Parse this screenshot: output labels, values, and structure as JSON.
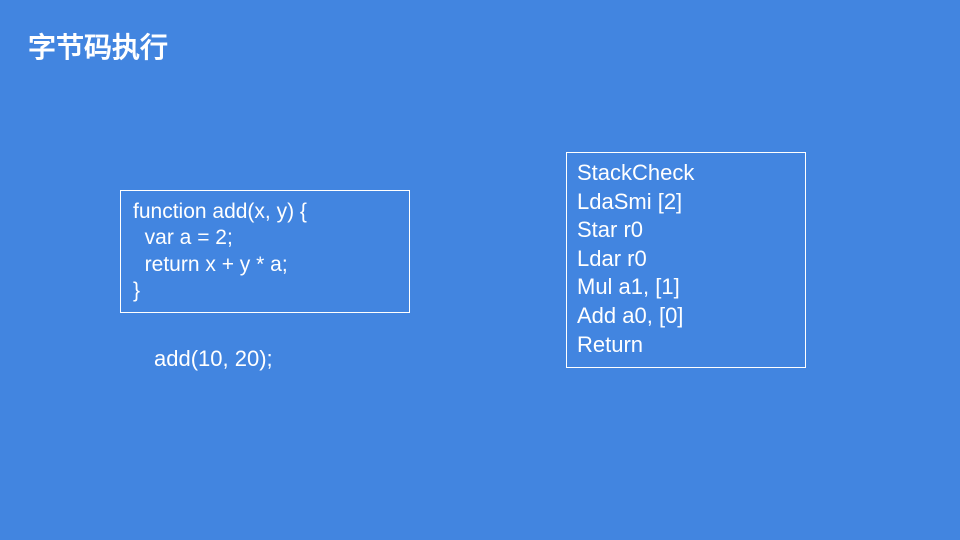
{
  "title": "字节码执行",
  "source_code": "function add(x, y) {\n  var a = 2;\n  return x + y * a;\n}",
  "call_line": "add(10, 20);",
  "bytecode": "StackCheck\nLdaSmi [2]\nStar r0\nLdar r0\nMul a1, [1]\nAdd a0, [0]\nReturn"
}
